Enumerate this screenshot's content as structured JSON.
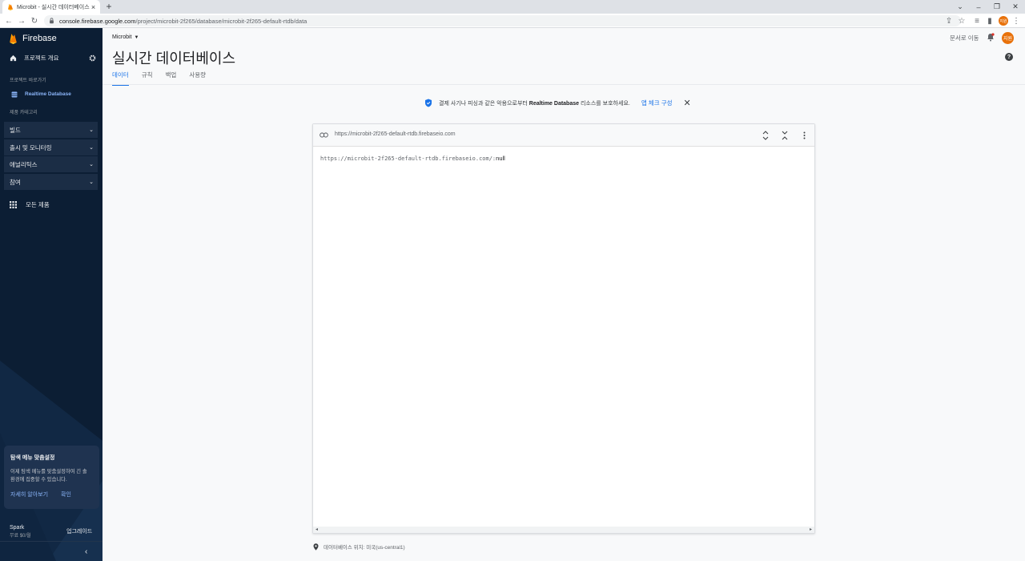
{
  "browser": {
    "tab_title": "Microbit - 실시간 데이터베이스",
    "tab_close": "×",
    "new_tab": "+",
    "url_host": "console.firebase.google.com",
    "url_path": "/project/microbit-2f265/database/microbit-2f265-default-rtdb/data",
    "profile_initials": "지원"
  },
  "sidebar": {
    "brand": "Firebase",
    "overview": "프로젝트 개요",
    "shortcuts_title": "프로젝트 바로가기",
    "active_item": "Realtime Database",
    "categories_title": "제품 카테고리",
    "groups": [
      {
        "label": "빌드"
      },
      {
        "label": "출시 및 모니터링"
      },
      {
        "label": "애널리틱스"
      },
      {
        "label": "참여"
      }
    ],
    "all_products": "모든 제품",
    "card": {
      "title": "탐색 메뉴 맞춤설정",
      "body": "이제 탐색 메뉴를 맞춤설정하여 긴 솔 환경에 집중할 수 있습니다.",
      "learn_more": "자세히 알아보기",
      "confirm": "확인"
    },
    "plan_name": "Spark",
    "plan_price": "무료 $0/월",
    "upgrade": "업그레이드"
  },
  "header": {
    "project": "Microbit",
    "docs": "문서로 이동",
    "title": "실시간 데이터베이스",
    "avatar_initials": "지원",
    "help": "?"
  },
  "tabs": [
    {
      "label": "데이터"
    },
    {
      "label": "규칙"
    },
    {
      "label": "백업"
    },
    {
      "label": "사용량"
    }
  ],
  "banner": {
    "message_prefix": "결제 사기나 피싱과 같은 악용으로부터 ",
    "message_strong": "Realtime Database",
    "message_suffix": " 리소스를 보호하세요.",
    "cta": "앱 체크 구성"
  },
  "database": {
    "header_url": "https://microbit-2f265-default-rtdb.firebaseio.com",
    "root_path": "https://microbit-2f265-default-rtdb.firebaseio.com/:",
    "root_value": "null"
  },
  "footer": {
    "location": "데이터베이스 위치: 미국(us-central1)"
  },
  "colors": {
    "accent": "#1a73e8",
    "sidebar_bg": "#0c1e34",
    "firebase_amber": "#ffca28",
    "avatar": "#e8710a"
  }
}
